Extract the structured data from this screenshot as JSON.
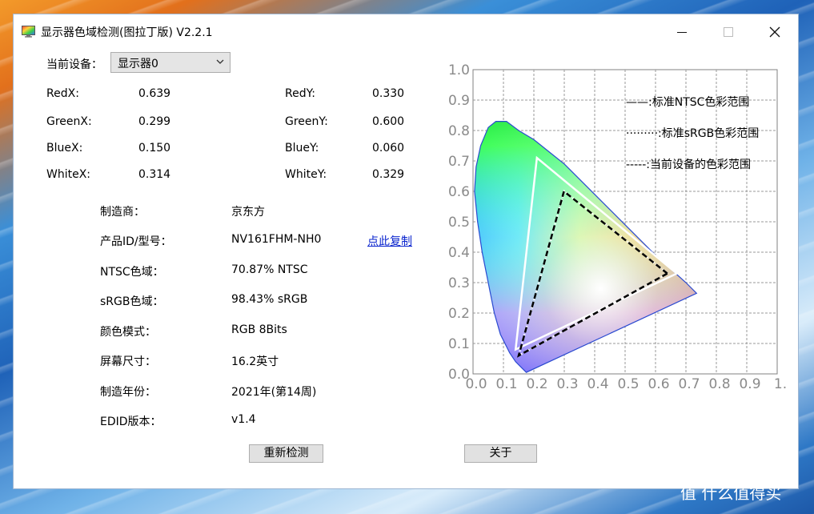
{
  "window": {
    "title": "显示器色域检测(图拉丁版) V2.2.1"
  },
  "device": {
    "label": "当前设备：",
    "selected": "显示器0"
  },
  "coords": [
    {
      "label": "RedX:",
      "value": "0.639"
    },
    {
      "label": "RedY:",
      "value": "0.330"
    },
    {
      "label": "GreenX:",
      "value": "0.299"
    },
    {
      "label": "GreenY:",
      "value": "0.600"
    },
    {
      "label": "BlueX:",
      "value": "0.150"
    },
    {
      "label": "BlueY:",
      "value": "0.060"
    },
    {
      "label": "WhiteX:",
      "value": "0.314"
    },
    {
      "label": "WhiteY:",
      "value": "0.329"
    }
  ],
  "info": [
    {
      "label": "制造商：",
      "value": "京东方"
    },
    {
      "label": "产品ID/型号：",
      "value": "NV161FHM-NH0"
    },
    {
      "label": "NTSC色域：",
      "value": "70.87% NTSC"
    },
    {
      "label": "sRGB色域：",
      "value": "98.43% sRGB"
    },
    {
      "label": "颜色模式：",
      "value": "RGB 8Bits"
    },
    {
      "label": "屏幕尺寸：",
      "value": "16.2英寸"
    },
    {
      "label": "制造年份：",
      "value": "2021年(第14周)"
    },
    {
      "label": "EDID版本：",
      "value": "v1.4"
    }
  ],
  "copy_link": "点此复制",
  "buttons": {
    "redetect": "重新检测",
    "about": "关于"
  },
  "watermark": "值 什么值得买",
  "chart_data": {
    "type": "scatter",
    "x_ticks": [
      "0.0",
      "0.1",
      "0.2",
      "0.3",
      "0.4",
      "0.5",
      "0.6",
      "0.7",
      "0.8",
      "0.9",
      "1."
    ],
    "y_ticks": [
      "0.0",
      "0.1",
      "0.2",
      "0.3",
      "0.4",
      "0.5",
      "0.6",
      "0.7",
      "0.8",
      "0.9",
      "1.0"
    ],
    "xlim": [
      0,
      1
    ],
    "ylim": [
      0,
      1
    ],
    "grid": true,
    "legend": [
      {
        "label": "——:标准NTSC色彩范围",
        "style": "solid"
      },
      {
        "label": "·········:标准sRGB色彩范围",
        "style": "dotted"
      },
      {
        "label": "-----:当前设备的色彩范围",
        "style": "dashed"
      }
    ],
    "legend_placement": "top-right",
    "series": [
      {
        "style": "solid",
        "color": "#ffffff",
        "points": [
          [
            0.67,
            0.33
          ],
          [
            0.21,
            0.71
          ],
          [
            0.14,
            0.08
          ]
        ]
      },
      {
        "style": "dotted",
        "color": "#ffffff",
        "points": [
          [
            0.64,
            0.33
          ],
          [
            0.3,
            0.6
          ],
          [
            0.15,
            0.06
          ]
        ]
      },
      {
        "style": "dashed",
        "color": "#000000",
        "points": [
          [
            0.639,
            0.33
          ],
          [
            0.299,
            0.6
          ],
          [
            0.15,
            0.06
          ]
        ]
      }
    ],
    "locus": [
      [
        0.175,
        0.005
      ],
      [
        0.17,
        0.01
      ],
      [
        0.16,
        0.02
      ],
      [
        0.14,
        0.04
      ],
      [
        0.12,
        0.07
      ],
      [
        0.09,
        0.13
      ],
      [
        0.07,
        0.2
      ],
      [
        0.05,
        0.3
      ],
      [
        0.03,
        0.4
      ],
      [
        0.015,
        0.5
      ],
      [
        0.005,
        0.6
      ],
      [
        0.01,
        0.68
      ],
      [
        0.025,
        0.75
      ],
      [
        0.05,
        0.81
      ],
      [
        0.075,
        0.83
      ],
      [
        0.11,
        0.83
      ],
      [
        0.15,
        0.8
      ],
      [
        0.2,
        0.77
      ],
      [
        0.25,
        0.73
      ],
      [
        0.3,
        0.69
      ],
      [
        0.35,
        0.64
      ],
      [
        0.4,
        0.59
      ],
      [
        0.45,
        0.54
      ],
      [
        0.5,
        0.49
      ],
      [
        0.55,
        0.44
      ],
      [
        0.6,
        0.39
      ],
      [
        0.65,
        0.345
      ],
      [
        0.7,
        0.3
      ],
      [
        0.735,
        0.265
      ]
    ]
  }
}
